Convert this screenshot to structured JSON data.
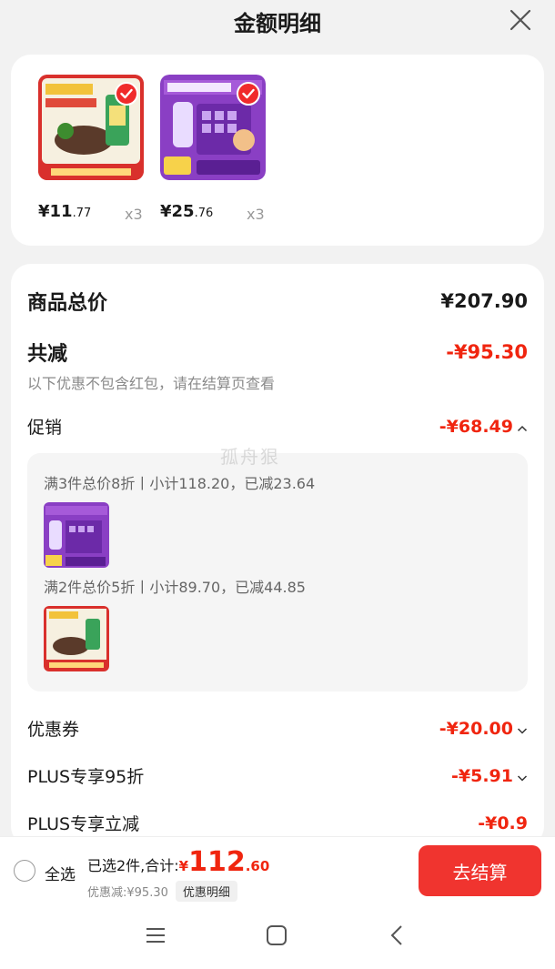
{
  "header": {
    "title": "金额明细"
  },
  "products": [
    {
      "price_main": "¥11",
      "price_decimal": ".77",
      "qty": "x3"
    },
    {
      "price_main": "¥25",
      "price_decimal": ".76",
      "qty": "x3"
    }
  ],
  "summary": {
    "total_label": "商品总价",
    "total_value": "¥207.90",
    "reduce_label": "共减",
    "reduce_value": "-¥95.30",
    "reduce_hint": "以下优惠不包含红包，请在结算页查看",
    "promo_label": "促销",
    "promo_value": "-¥68.49",
    "promo_lines": [
      "满3件总价8折丨小计118.20，已减23.64",
      "满2件总价5折丨小计89.70，已减44.85"
    ],
    "coupon_label": "优惠券",
    "coupon_value": "-¥20.00",
    "plus95_label": "PLUS专享95折",
    "plus95_value": "-¥5.91",
    "plusreduce_label": "PLUS专享立减",
    "plusreduce_value": "-¥0.9"
  },
  "watermark": "孤舟狠",
  "bottom": {
    "select_all": "全选",
    "selected_text": "已选2件,合计:",
    "total_symbol": "¥",
    "total_main": "112",
    "total_decimal": ".60",
    "discount_text": "优惠减:¥95.30",
    "detail_chip": "优惠明细",
    "checkout": "去结算"
  },
  "colors": {
    "accent_red": "#f0250f",
    "checkout_bg": "#f0342f"
  },
  "icons": [
    "close-icon",
    "check-icon",
    "chevron-up-icon",
    "chevron-down-icon",
    "menu-icon",
    "home-icon",
    "back-icon"
  ]
}
